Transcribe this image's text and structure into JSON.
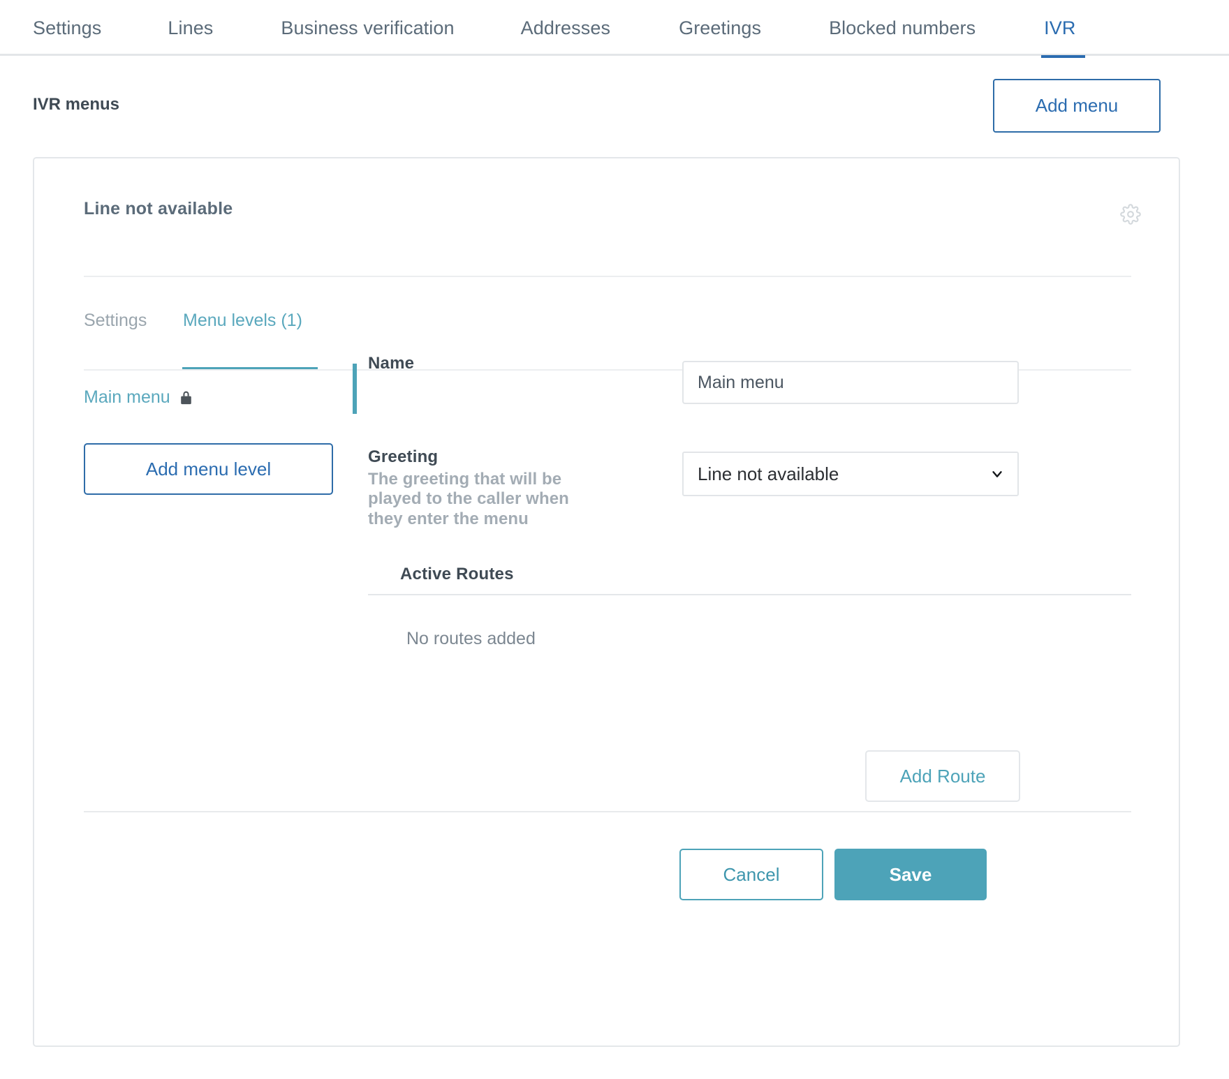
{
  "top_tabs": [
    {
      "label": "Settings",
      "active": false,
      "gap": 95
    },
    {
      "label": "Lines",
      "active": false,
      "gap": 97
    },
    {
      "label": "Business verification",
      "active": false,
      "gap": 95
    },
    {
      "label": "Addresses",
      "active": false,
      "gap": 98
    },
    {
      "label": "Greetings",
      "active": false,
      "gap": 97
    },
    {
      "label": "Blocked numbers",
      "active": false,
      "gap": 98
    },
    {
      "label": "IVR",
      "active": true,
      "gap": 0
    }
  ],
  "header": {
    "title": "IVR menus",
    "add_menu_label": "Add menu"
  },
  "card": {
    "title": "Line not available",
    "gear_icon": "gear-icon",
    "inner_tabs": [
      {
        "label": "Settings",
        "active": false
      },
      {
        "label": "Menu levels (1)",
        "active": true
      }
    ],
    "left_panel": {
      "menu_levels": [
        {
          "label": "Main menu",
          "locked": true,
          "lock_icon": "lock-icon"
        }
      ],
      "add_menu_level_label": "Add menu level"
    },
    "form": {
      "name": {
        "label": "Name",
        "value": "Main menu",
        "placeholder": "Name"
      },
      "greeting": {
        "label": "Greeting",
        "help": "The greeting that will be played to the caller when they enter the menu",
        "selected": "Line not available",
        "chevron_icon": "chevron-down-icon"
      }
    },
    "routes": {
      "title": "Active Routes",
      "empty_text": "No routes added",
      "add_route_label": "Add Route"
    },
    "footer": {
      "cancel_label": "Cancel",
      "save_label": "Save"
    }
  },
  "colors": {
    "accent_blue": "#2b6cb0",
    "accent_teal": "#4da3b8",
    "text_dark": "#3f4a54",
    "text_muted": "#9aa5ad"
  }
}
